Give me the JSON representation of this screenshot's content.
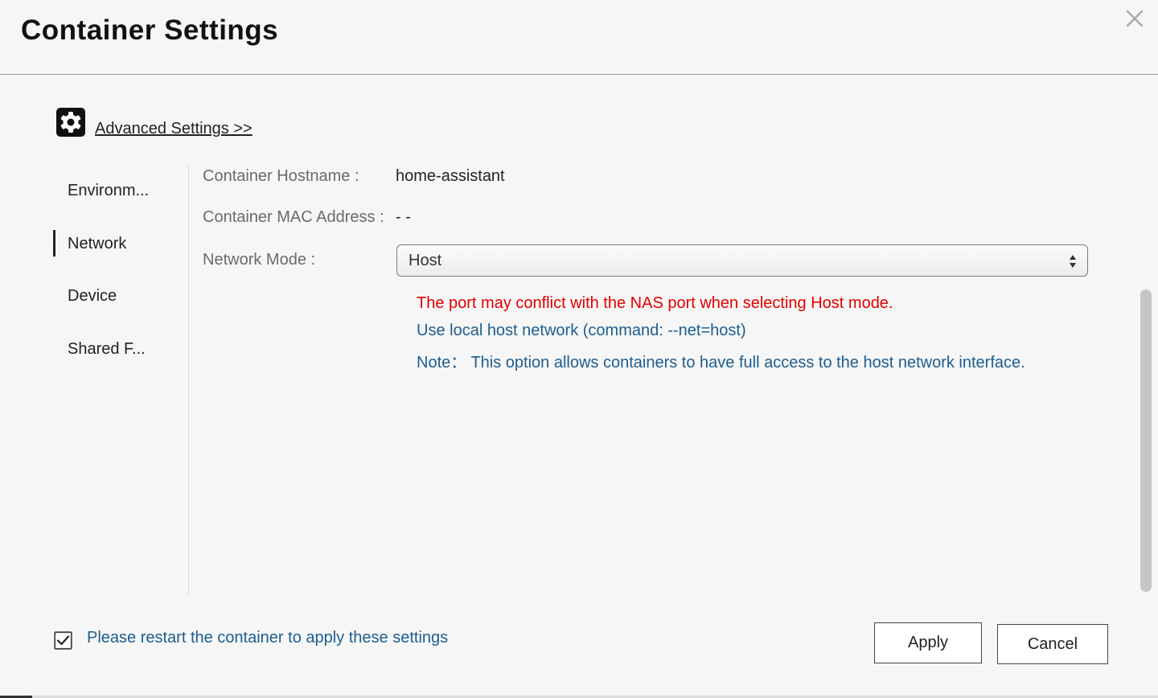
{
  "dialog": {
    "title": "Container Settings",
    "close_icon": "close-icon"
  },
  "advanced": {
    "icon": "gear-icon",
    "link_label": "Advanced Settings >>"
  },
  "sidebar": {
    "items": [
      {
        "label": "Environm..."
      },
      {
        "label": "Network",
        "active": true
      },
      {
        "label": "Device"
      },
      {
        "label": "Shared F..."
      }
    ]
  },
  "network": {
    "hostname_label": "Container Hostname :",
    "hostname_value": "home-assistant",
    "mac_label": "Container MAC Address :",
    "mac_value": "- -",
    "mode_label": "Network Mode :",
    "mode_selected": "Host",
    "warning": "The port may conflict with the NAS port when selecting Host mode.",
    "info_command": "Use local host network (command: --net=host)",
    "info_note": "Note： This option allows containers to have full access to the host network interface."
  },
  "footer": {
    "restart_checked": true,
    "restart_label": "Please restart the container to apply these settings",
    "apply_label": "Apply",
    "cancel_label": "Cancel"
  },
  "colors": {
    "warning": "#e00000",
    "info": "#1d5d8f",
    "background": "#f6f6f6"
  }
}
